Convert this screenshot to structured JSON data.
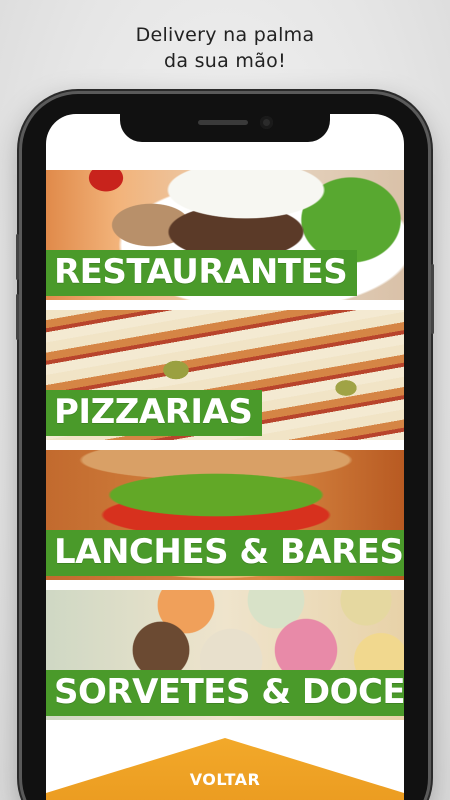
{
  "tagline": {
    "line1": "Delivery na palma",
    "line2": "da sua mão!"
  },
  "categories": [
    {
      "label": "RESTAURANTES"
    },
    {
      "label": "PIZZARIAS"
    },
    {
      "label": "LANCHES & BARES"
    },
    {
      "label": "SORVETES & DOCES"
    }
  ],
  "footer": {
    "back_label": "VOLTAR"
  },
  "colors": {
    "accent_green": "#4a9a2a",
    "back_orange": "#f2a92a"
  }
}
